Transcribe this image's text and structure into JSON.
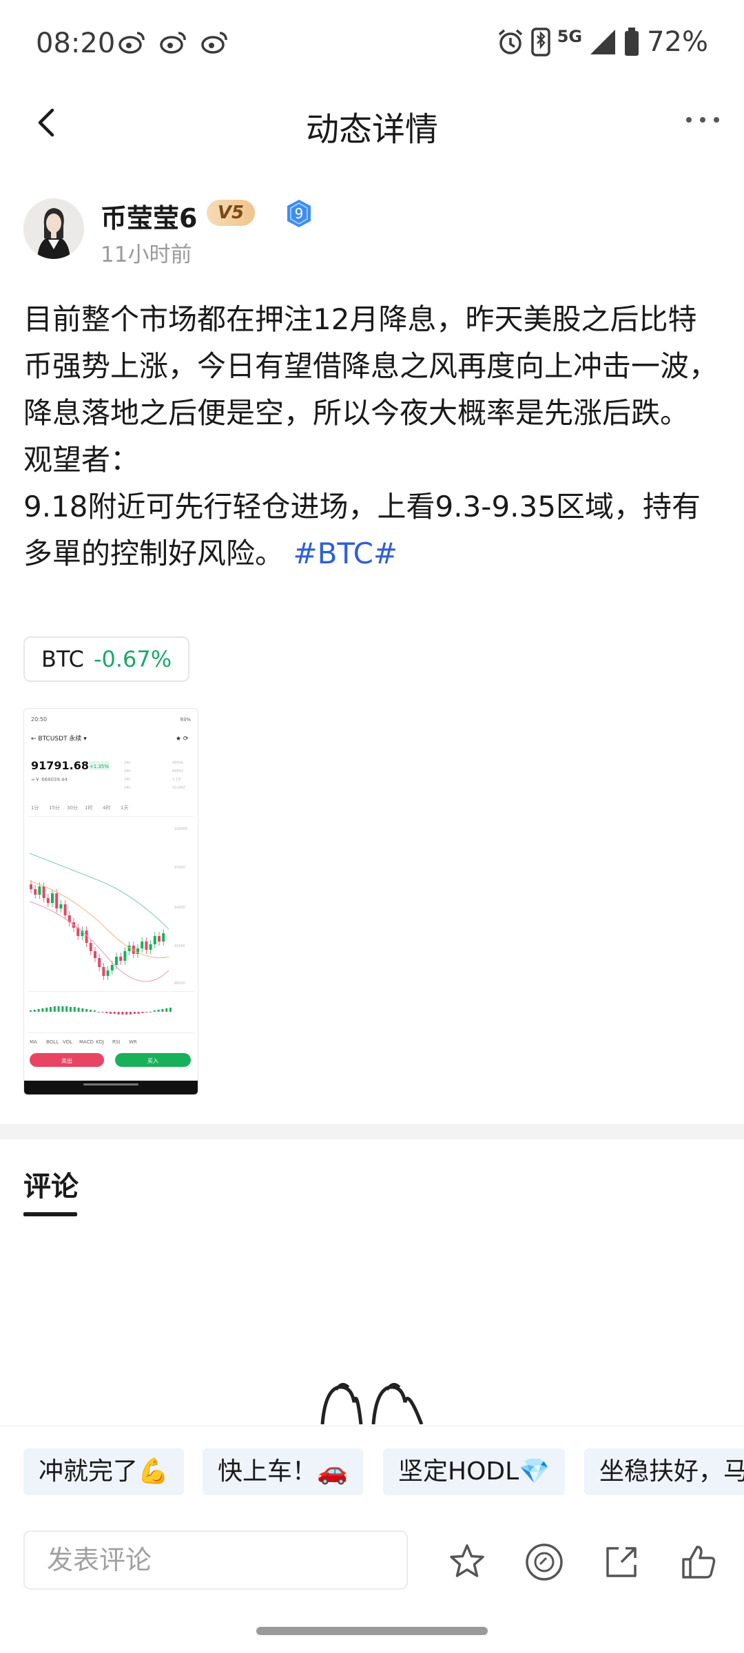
{
  "status_bar": {
    "time": "08:20",
    "network": "5G",
    "battery": "72%",
    "icons": [
      "weibo-icon",
      "weibo-icon",
      "weibo-icon",
      "alarm-icon",
      "bluetooth-icon",
      "signal-icon",
      "battery-icon"
    ]
  },
  "header": {
    "title": "动态详情"
  },
  "author": {
    "name": "币莹莹6",
    "vip": "V5",
    "level": "9",
    "time_ago": "11小时前"
  },
  "post": {
    "paragraph1": "目前整个市场都在押注12月降息，昨天美股之后比特币强势上涨，今日有望借降息之风再度向上冲击一波，降息落地之后便是空，所以今夜大概率是先涨后跌。",
    "paragraph2": "观望者：",
    "paragraph3": "9.18附近可先行轻仓进场，上看9.3-9.35区域，持有多單的控制好风险。",
    "hashtag": "#BTC#"
  },
  "coin_chip": {
    "symbol": "BTC",
    "change": "-0.67%",
    "change_color": "#1aa86c"
  },
  "thumbnail": {
    "status_time": "20:50",
    "battery": "93%",
    "pair": "BTCUSDT 永续",
    "price": "91791.68",
    "change": "+1.35%",
    "fiat": "≈￥ 668039.44",
    "intervals": [
      "1分",
      "15分",
      "30分",
      "1时",
      "4时",
      "1天"
    ],
    "bottom_tabs": [
      "MA",
      "BOLL",
      "VOL",
      "MACD",
      "KDJ",
      "RSI",
      "WR"
    ],
    "sell_label": "卖出",
    "buy_label": "买入"
  },
  "comments": {
    "tab_label": "评论"
  },
  "quick_replies": [
    "冲就完了💪",
    "快上车！🚗",
    "坚定HODL💎",
    "坐稳扶好，马"
  ],
  "input": {
    "placeholder": "发表评论"
  },
  "actions": [
    "star-icon",
    "coin-icon",
    "share-icon",
    "like-icon"
  ],
  "colors": {
    "accent_blue": "#2f5fd6",
    "up_green": "#1aa86c",
    "vip_gold": "#f0c48d"
  }
}
